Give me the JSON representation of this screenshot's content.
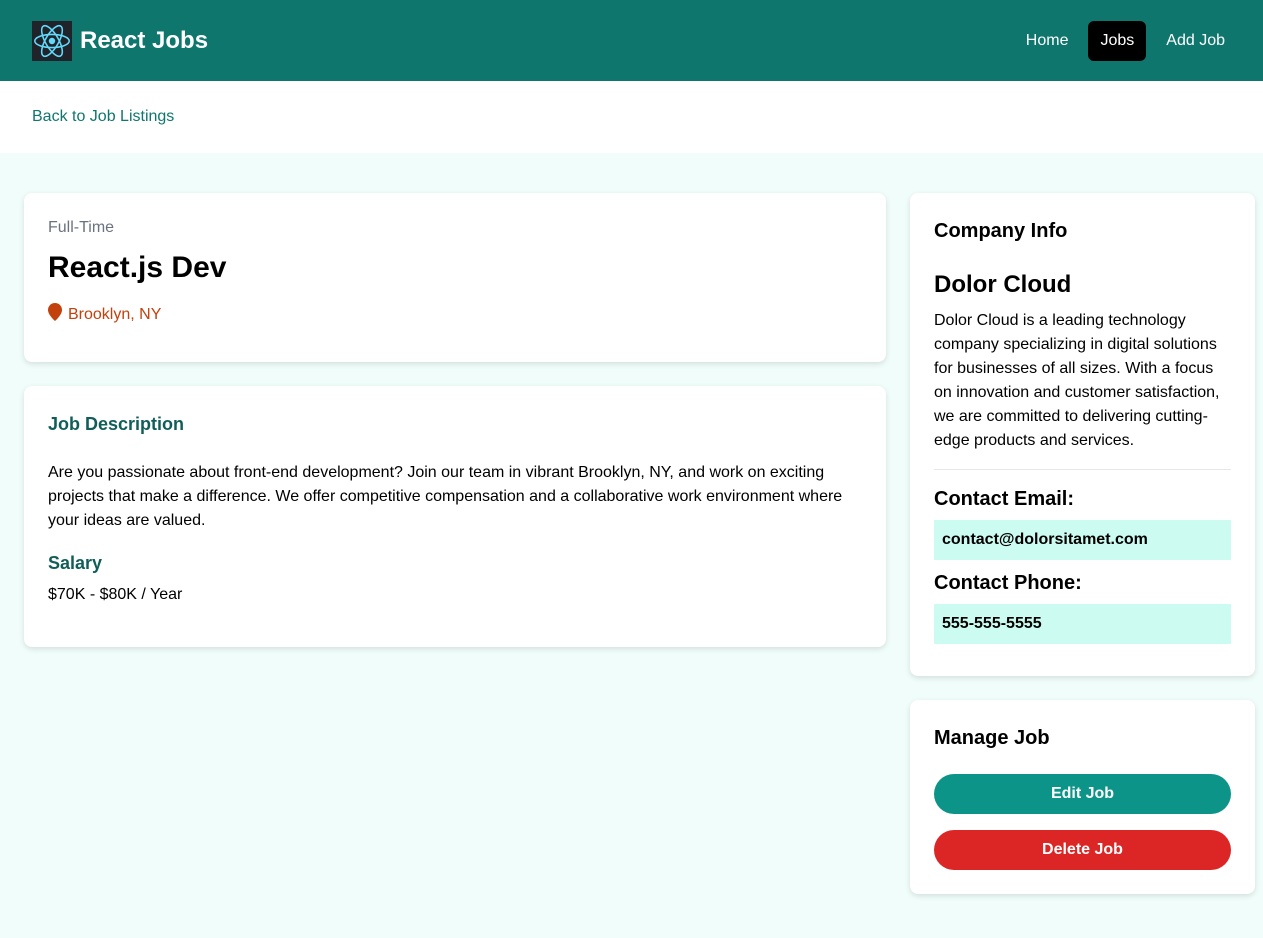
{
  "nav": {
    "brand": "React Jobs",
    "links": [
      {
        "label": "Home"
      },
      {
        "label": "Jobs"
      },
      {
        "label": "Add Job"
      }
    ],
    "active": "Jobs"
  },
  "back_link": "Back to Job Listings",
  "job": {
    "type": "Full-Time",
    "title": "React.js Dev",
    "location": "Brooklyn, NY",
    "description_heading": "Job Description",
    "description": "Are you passionate about front-end development? Join our team in vibrant Brooklyn, NY, and work on exciting projects that make a difference. We offer competitive compensation and a collaborative work environment where your ideas are valued.",
    "salary_heading": "Salary",
    "salary": "$70K - $80K / Year"
  },
  "company": {
    "heading": "Company Info",
    "name": "Dolor Cloud",
    "description": "Dolor Cloud is a leading technology company specializing in digital solutions for businesses of all sizes. With a focus on innovation and customer satisfaction, we are committed to delivering cutting-edge products and services.",
    "email_label": "Contact Email:",
    "email": "contact@dolorsitamet.com",
    "phone_label": "Contact Phone:",
    "phone": "555-555-5555"
  },
  "manage": {
    "heading": "Manage Job",
    "edit_label": "Edit Job",
    "delete_label": "Delete Job"
  },
  "icons": {
    "logo": "react-logo-icon",
    "location": "map-marker-icon"
  },
  "colors": {
    "navbar": "#0f766e",
    "background": "#f0fdfa",
    "accent": "#0d9488",
    "danger": "#dc2626",
    "location": "#c2410c",
    "contact_bg": "#ccfbf1"
  }
}
